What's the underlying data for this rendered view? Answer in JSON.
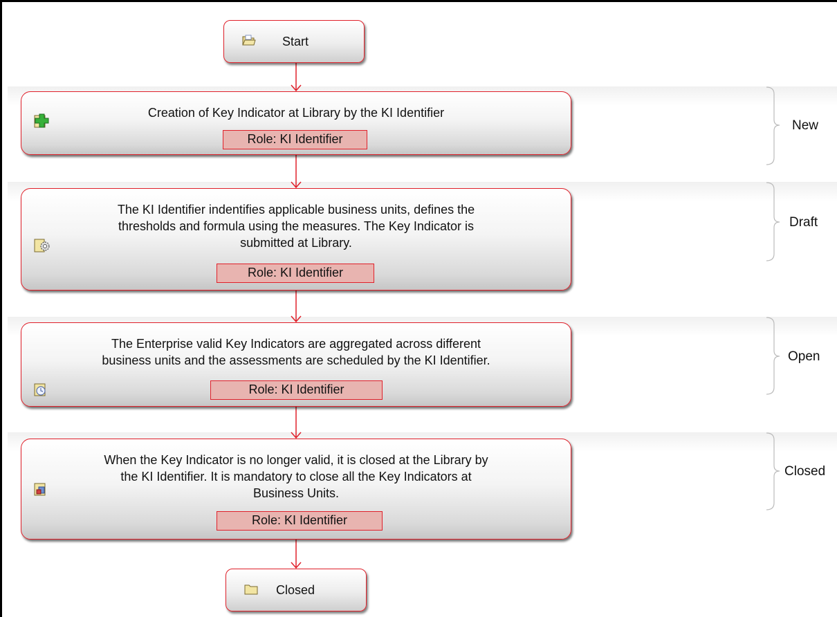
{
  "start": {
    "label": "Start",
    "icon": "folder-open-icon"
  },
  "end": {
    "label": "Closed",
    "icon": "folder-icon"
  },
  "steps": [
    {
      "text": [
        "Creation of Key Indicator at Library by the KI Identifier"
      ],
      "role": "Role: KI Identifier",
      "icon": "add-document-icon",
      "stage": "New"
    },
    {
      "text": [
        "The KI Identifier indentifies applicable business units, defines the",
        "thresholds and formula using the measures. The  Key Indicator is",
        "submitted at Library."
      ],
      "role": "Role: KI Identifier",
      "icon": "settings-document-icon",
      "stage": "Draft"
    },
    {
      "text": [
        "The Enterprise valid Key Indicators are aggregated across different",
        "business units and the assessments are scheduled by the KI Identifier."
      ],
      "role": "Role: KI Identifier",
      "icon": "clock-document-icon",
      "stage": "Open"
    },
    {
      "text": [
        "When the Key Indicator is no longer valid, it is closed at the Library by",
        "the KI Identifier. It is mandatory to close all the Key Indicators at",
        "Business Units."
      ],
      "role": "Role: KI Identifier",
      "icon": "close-document-icon",
      "stage": "Closed"
    }
  ],
  "colors": {
    "border": "#e0202a",
    "role_fill": "#e8b4b0",
    "arrow": "#e0202a"
  }
}
